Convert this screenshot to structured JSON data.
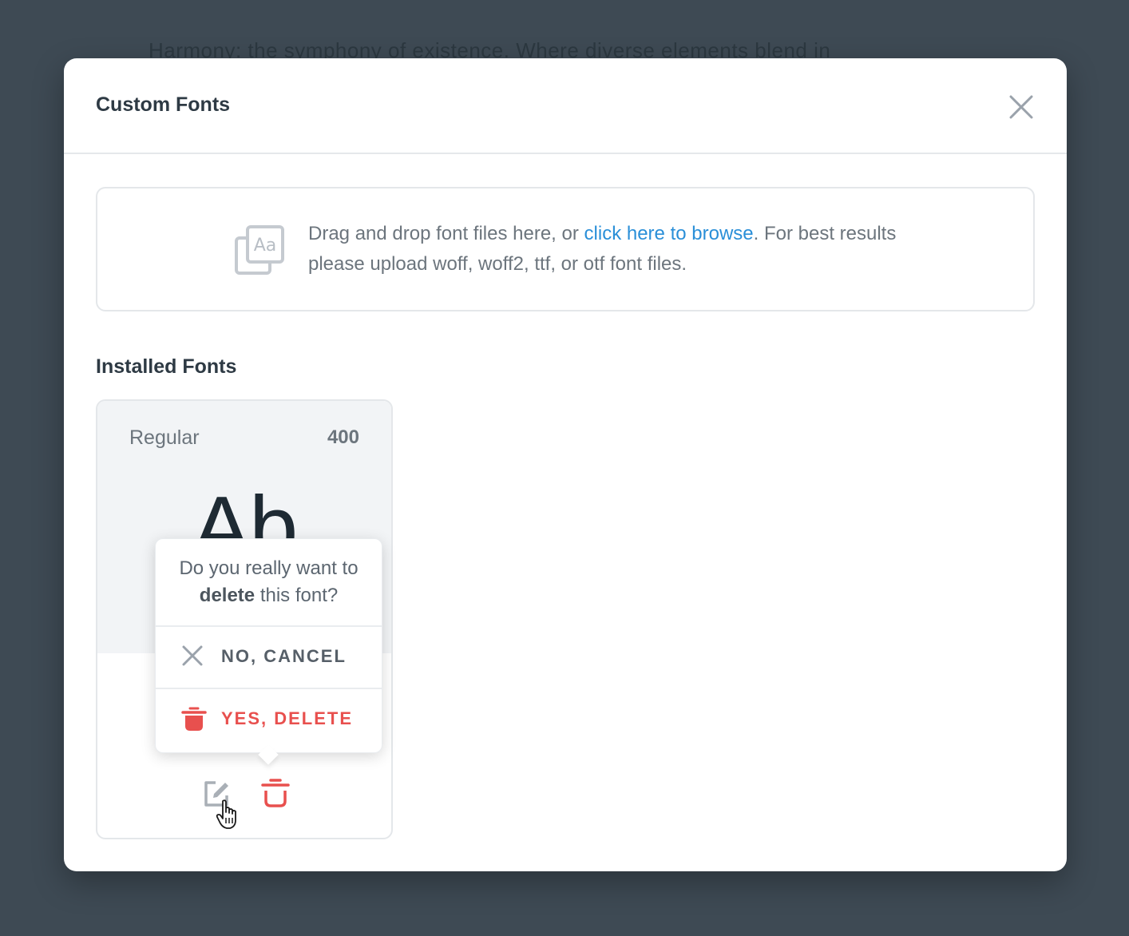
{
  "background_text": "Harmony: the symphony of existence. Where diverse elements blend in",
  "modal": {
    "title": "Custom Fonts",
    "close_icon": "close-icon"
  },
  "dropzone": {
    "icon": "font-file-icon",
    "text_before": "Drag and drop font files here, or ",
    "link_text": "click here to browse",
    "text_after": ". For best results please upload woff, woff2, ttf, or otf font files."
  },
  "installed": {
    "title": "Installed Fonts",
    "fonts": [
      {
        "style": "Regular",
        "weight": "400",
        "sample": "Ab"
      }
    ]
  },
  "confirm": {
    "question_prefix": "Do you really want to ",
    "question_bold": "delete",
    "question_suffix": " this font?",
    "cancel_label": "NO, CANCEL",
    "delete_label": "YES, DELETE"
  },
  "colors": {
    "accent_link": "#2a8fd8",
    "danger": "#e8504e",
    "overlay": "#3e4a54"
  }
}
